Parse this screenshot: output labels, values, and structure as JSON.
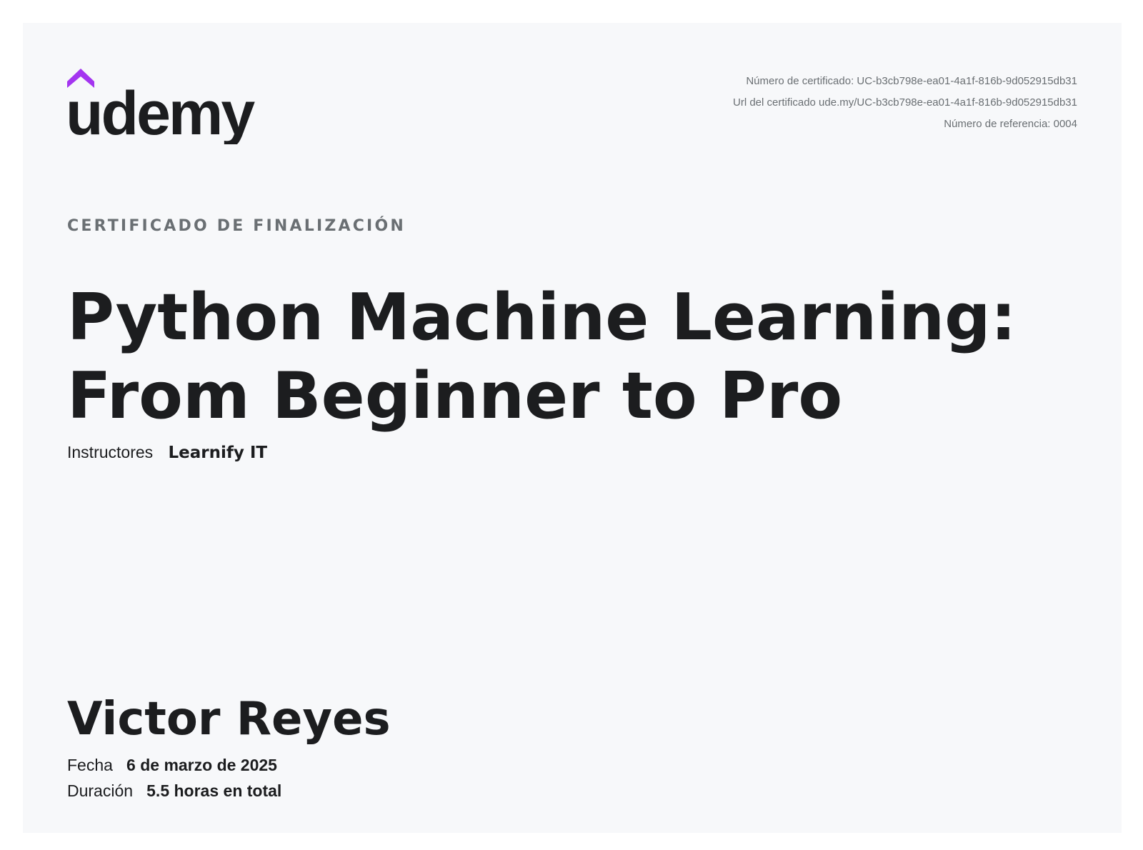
{
  "header": {
    "logo_text": "ûdemy",
    "certificate_number": "Número de certificado: UC-b3cb798e-ea01-4a1f-816b-9d052915db31",
    "certificate_url": "Url del certificado ude.my/UC-b3cb798e-ea01-4a1f-816b-9d052915db31",
    "reference_number": "Número de referencia: 0004"
  },
  "certificate": {
    "label": "CERTIFICADO DE FINALIZACIÓN",
    "title_line1": "Python Machine Learning:",
    "title_line2": "From Beginner to Pro",
    "instructors_label": "Instructores",
    "instructors_value": "Learnify IT",
    "student_name": "Victor Reyes",
    "date_label": "Fecha",
    "date_value": "6 de marzo de 2025",
    "duration_label": "Duración",
    "duration_value": "5.5 horas en total"
  },
  "colors": {
    "brand_purple": "#a435f0",
    "text_dark": "#1c1d1f",
    "text_muted": "#6a6f73",
    "paper": "#f7f8fa"
  }
}
